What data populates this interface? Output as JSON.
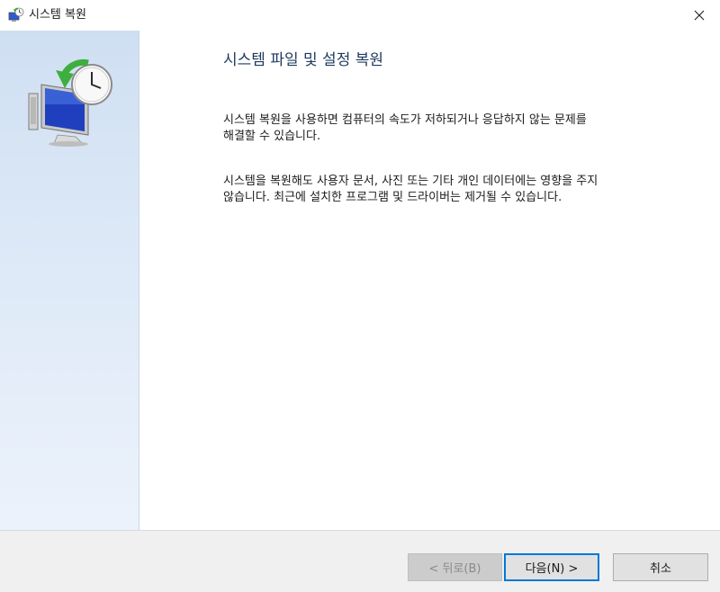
{
  "window": {
    "title": "시스템 복원",
    "close_icon": "close-icon",
    "app_icon": "system-restore-icon"
  },
  "content": {
    "heading": "시스템 파일 및 설정 복원",
    "paragraph1_line1": "시스템 복원을 사용하면 컴퓨터의 속도가 저하되거나 응답하지 않는 문제를",
    "paragraph1_line2": "해결할 수 있습니다.",
    "paragraph2_line1": "시스템을 복원해도 사용자 문서, 사진 또는 기타 개인 데이터에는 영향을 주지",
    "paragraph2_line2": "않습니다. 최근에 설치한 프로그램 및 드라이버는 제거될 수 있습니다."
  },
  "buttons": {
    "back": "< 뒤로(B)",
    "next": "다음(N) >",
    "cancel": "취소"
  },
  "colors": {
    "accent": "#0078d7",
    "heading": "#1e3a5f",
    "side_panel": "#dde9f7"
  }
}
